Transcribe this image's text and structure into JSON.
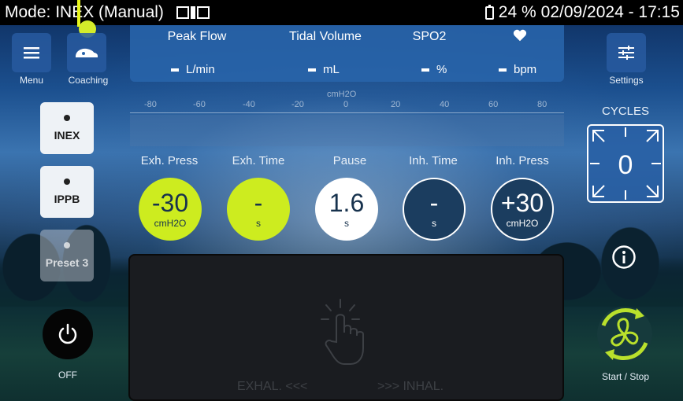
{
  "statusbar": {
    "mode": "Mode: INEX (Manual)",
    "battery": "24 %",
    "datetime": "02/09/2024 - 17:15"
  },
  "nav": {
    "menu_label": "Menu",
    "coaching_label": "Coaching",
    "settings_label": "Settings"
  },
  "modes": [
    {
      "label": "INEX",
      "enabled": true
    },
    {
      "label": "IPPB",
      "enabled": true
    },
    {
      "label": "Preset 3",
      "enabled": false
    }
  ],
  "metrics": [
    {
      "label": "Peak Flow",
      "value": "-",
      "unit": "L/min"
    },
    {
      "label": "Tidal Volume",
      "value": "-",
      "unit": "mL"
    },
    {
      "label": "SPO2",
      "value": "-",
      "unit": "%"
    },
    {
      "label": "",
      "icon": "heart-icon",
      "value": "-",
      "unit": "bpm"
    }
  ],
  "scale": {
    "unit": "cmH2O",
    "ticks": [
      "-80",
      "-60",
      "-40",
      "-20",
      "0",
      "20",
      "40",
      "60",
      "80"
    ]
  },
  "params": [
    {
      "label": "Exh. Press",
      "value": "-30",
      "unit": "cmH2O",
      "style": "green"
    },
    {
      "label": "Exh. Time",
      "value": "-",
      "unit": "s",
      "style": "green"
    },
    {
      "label": "Pause",
      "value": "1.6",
      "unit": "s",
      "style": "white"
    },
    {
      "label": "Inh. Time",
      "value": "-",
      "unit": "s",
      "style": "dark"
    },
    {
      "label": "Inh. Press",
      "value": "+30",
      "unit": "cmH2O",
      "style": "dark"
    }
  ],
  "touchpad": {
    "left_label": "EXHAL. <<<",
    "right_label": ">>> INHAL."
  },
  "cycles": {
    "label": "CYCLES",
    "value": "0"
  },
  "power": {
    "label": "OFF"
  },
  "start_stop": {
    "label": "Start / Stop"
  },
  "colors": {
    "accent_green": "#cdec1f",
    "panel_blue": "#2864aa",
    "marker_yellow": "#e7f51b"
  }
}
